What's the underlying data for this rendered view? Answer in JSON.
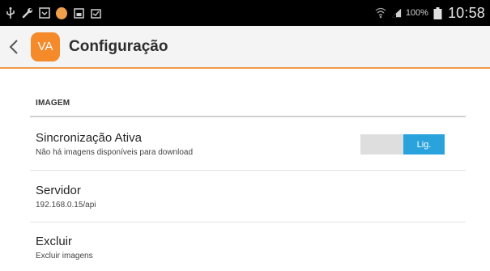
{
  "status_bar": {
    "battery": "100%",
    "time": "10:58"
  },
  "header": {
    "back_icon": "chevron-left-icon",
    "logo_text": "VA",
    "title": "Configuração"
  },
  "section": {
    "header": "IMAGEM"
  },
  "settings": [
    {
      "title": "Sincronização Ativa",
      "subtitle": "Não há imagens disponíveis para download",
      "toggle_label": "Lig."
    },
    {
      "title": "Servidor",
      "subtitle": "192.168.0.15/api"
    },
    {
      "title": "Excluir",
      "subtitle": "Excluir imagens"
    }
  ],
  "colors": {
    "accent": "#f39a45",
    "logo": "#f58a2b",
    "toggle_on": "#2aa3dd",
    "status_bar": "#000000",
    "app_bar": "#f4f4f4"
  }
}
